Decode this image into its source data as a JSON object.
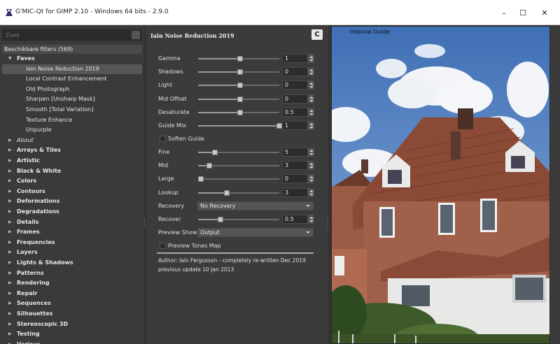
{
  "window": {
    "title": "G'MIC-Qt for GIMP 2.10 - Windows 64 bits - 2.9.0",
    "minimize": "–",
    "maximize": "☐",
    "close": "✕"
  },
  "search": {
    "placeholder": "Zoek"
  },
  "filters_header": "Beschikbare filters (569)",
  "tree": [
    {
      "label": "Faves",
      "kind": "folder-open",
      "bold": true
    },
    {
      "label": "Iain Noise Reduction 2019",
      "kind": "filter",
      "selected": true
    },
    {
      "label": "Local Contrast Enhancement",
      "kind": "filter"
    },
    {
      "label": "Old Photograph",
      "kind": "filter"
    },
    {
      "label": "Sharpen [Unsharp Mask]",
      "kind": "filter"
    },
    {
      "label": "Smooth [Total Variation]",
      "kind": "filter"
    },
    {
      "label": "Texture Enhance",
      "kind": "filter"
    },
    {
      "label": "Unpurple",
      "kind": "filter"
    },
    {
      "label": "About",
      "kind": "folder",
      "italic": true
    },
    {
      "label": "Arrays & Tiles",
      "kind": "folder",
      "bold": true
    },
    {
      "label": "Artistic",
      "kind": "folder",
      "bold": true
    },
    {
      "label": "Black & White",
      "kind": "folder",
      "bold": true
    },
    {
      "label": "Colors",
      "kind": "folder",
      "bold": true
    },
    {
      "label": "Contours",
      "kind": "folder",
      "bold": true
    },
    {
      "label": "Deformations",
      "kind": "folder",
      "bold": true
    },
    {
      "label": "Degradations",
      "kind": "folder",
      "bold": true
    },
    {
      "label": "Details",
      "kind": "folder",
      "bold": true
    },
    {
      "label": "Frames",
      "kind": "folder",
      "bold": true
    },
    {
      "label": "Frequencies",
      "kind": "folder",
      "bold": true
    },
    {
      "label": "Layers",
      "kind": "folder",
      "bold": true
    },
    {
      "label": "Lights & Shadows",
      "kind": "folder",
      "bold": true
    },
    {
      "label": "Patterns",
      "kind": "folder",
      "bold": true
    },
    {
      "label": "Rendering",
      "kind": "folder",
      "bold": true
    },
    {
      "label": "Repair",
      "kind": "folder",
      "bold": true
    },
    {
      "label": "Sequences",
      "kind": "folder",
      "bold": true
    },
    {
      "label": "Silhouettes",
      "kind": "folder",
      "bold": true
    },
    {
      "label": "Stereoscopic 3D",
      "kind": "folder",
      "bold": true
    },
    {
      "label": "Testing",
      "kind": "folder",
      "bold": true
    },
    {
      "label": "Various",
      "kind": "folder",
      "bold": true
    }
  ],
  "filter": {
    "name": "Iain Noise Reduction 2019",
    "refresh_icon": "C",
    "params": [
      {
        "label": "Gamma",
        "value": "1",
        "level": 0.5
      },
      {
        "label": "Shadows",
        "value": "0",
        "level": 0.5
      },
      {
        "label": "Light",
        "value": "0",
        "level": 0.5
      },
      {
        "label": "Mid Offset",
        "value": "0",
        "level": 0.5
      },
      {
        "label": "Desaturate",
        "value": "0.5",
        "level": 0.5
      },
      {
        "label": "Guide Mix",
        "value": "1",
        "level": 1.0
      }
    ],
    "soften_guide": "Soften Guide",
    "params2": [
      {
        "label": "Fine",
        "value": "5",
        "level": 0.18
      },
      {
        "label": "Mid",
        "value": "3",
        "level": 0.11
      },
      {
        "label": "Large",
        "value": "0",
        "level": 0.0
      },
      {
        "label": "Lookup",
        "value": "3",
        "level": 0.33
      }
    ],
    "recovery_label": "Recovery",
    "recovery_value": "No Recovery",
    "recover_label": "Recover",
    "recover_value": "0.5",
    "recover_level": 0.25,
    "preview_shows_label": "Preview Shows",
    "preview_shows_value": "Output",
    "preview_tones_map": "Preview Tones Map",
    "author": "Author: Iain Fergusson - completely re-written Dec 2019",
    "updated": "previous update 10 Jan 2013"
  },
  "preview": {
    "label": "Internal Guide"
  },
  "colors": {
    "accent": "#c8c8c8",
    "panel": "#3b3b3b"
  }
}
